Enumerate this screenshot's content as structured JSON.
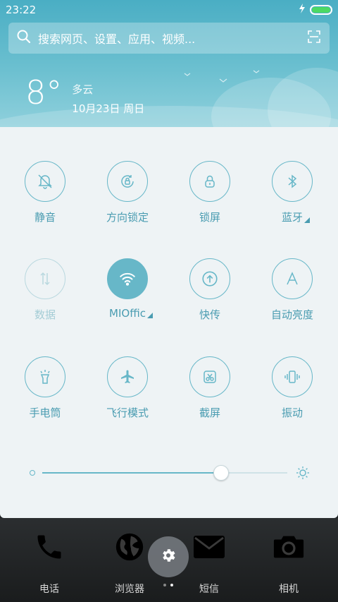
{
  "status_bar": {
    "time": "23:22"
  },
  "search": {
    "placeholder": "搜索网页、设置、应用、视频..."
  },
  "weather": {
    "temperature": "8°",
    "condition": "多云",
    "date": "10月23日 周日"
  },
  "toggles": [
    {
      "label": "静音",
      "icon": "bell-off-icon"
    },
    {
      "label": "方向锁定",
      "icon": "rotation-lock-icon"
    },
    {
      "label": "锁屏",
      "icon": "lock-icon"
    },
    {
      "label": "蓝牙",
      "icon": "bluetooth-icon"
    },
    {
      "label": "数据",
      "icon": "data-arrows-icon"
    },
    {
      "label": "MIOffic",
      "icon": "wifi-icon"
    },
    {
      "label": "快传",
      "icon": "upload-icon"
    },
    {
      "label": "自动亮度",
      "icon": "auto-brightness-icon"
    },
    {
      "label": "手电筒",
      "icon": "flashlight-icon"
    },
    {
      "label": "飞行模式",
      "icon": "airplane-icon"
    },
    {
      "label": "截屏",
      "icon": "screenshot-icon"
    },
    {
      "label": "振动",
      "icon": "vibrate-icon"
    }
  ],
  "brightness": {
    "level": 0.73
  },
  "dock": [
    {
      "label": "电话",
      "icon": "phone-icon"
    },
    {
      "label": "浏览器",
      "icon": "globe-icon"
    },
    {
      "label": "短信",
      "icon": "mail-icon"
    },
    {
      "label": "相机",
      "icon": "camera-icon"
    }
  ],
  "colors": {
    "accent": "#67b7c8",
    "accent_text": "#4a9cb1",
    "panel_bg": "#eef3f5",
    "header_blue": "#4aaec4"
  }
}
